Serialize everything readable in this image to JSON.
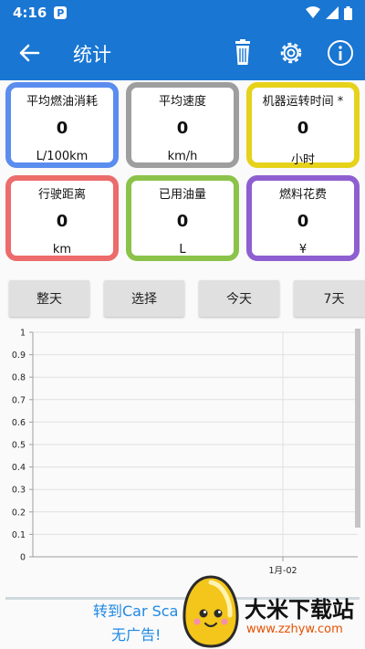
{
  "status": {
    "time": "4:16",
    "app_badge": "P"
  },
  "header": {
    "title": "统计"
  },
  "cards": [
    {
      "label": "平均燃油消耗",
      "value": "0",
      "unit": "L/100km",
      "color": "#5b8def"
    },
    {
      "label": "平均速度",
      "value": "0",
      "unit": "km/h",
      "color": "#9e9e9e"
    },
    {
      "label": "机器运转时间 *",
      "value": "0",
      "unit": "小时",
      "color": "#e6d21a"
    },
    {
      "label": "行驶距离",
      "value": "0",
      "unit": "km",
      "color": "#ec6b6b"
    },
    {
      "label": "已用油量",
      "value": "0",
      "unit": "L",
      "color": "#8bc34a"
    },
    {
      "label": "燃料花费",
      "value": "0",
      "unit": "¥",
      "color": "#8e5fd0"
    }
  ],
  "ranges": [
    "整天",
    "选择",
    "今天",
    "7天"
  ],
  "chart_data": {
    "type": "line",
    "yticks": [
      "0",
      "0.1",
      "0.2",
      "0.3",
      "0.4",
      "0.5",
      "0.6",
      "0.7",
      "0.8",
      "0.9",
      "1"
    ],
    "ylim": [
      0,
      1
    ],
    "xticks": [
      "1月-02"
    ],
    "series": [],
    "grid": true
  },
  "banner": {
    "line1": "转到Car Sca",
    "line2": "无广告!"
  },
  "watermark": {
    "title": "大米下载站",
    "url": "www.zzhyw.com"
  },
  "colors": {
    "primary": "#1976d2",
    "banner_text": "#1e88e5"
  }
}
